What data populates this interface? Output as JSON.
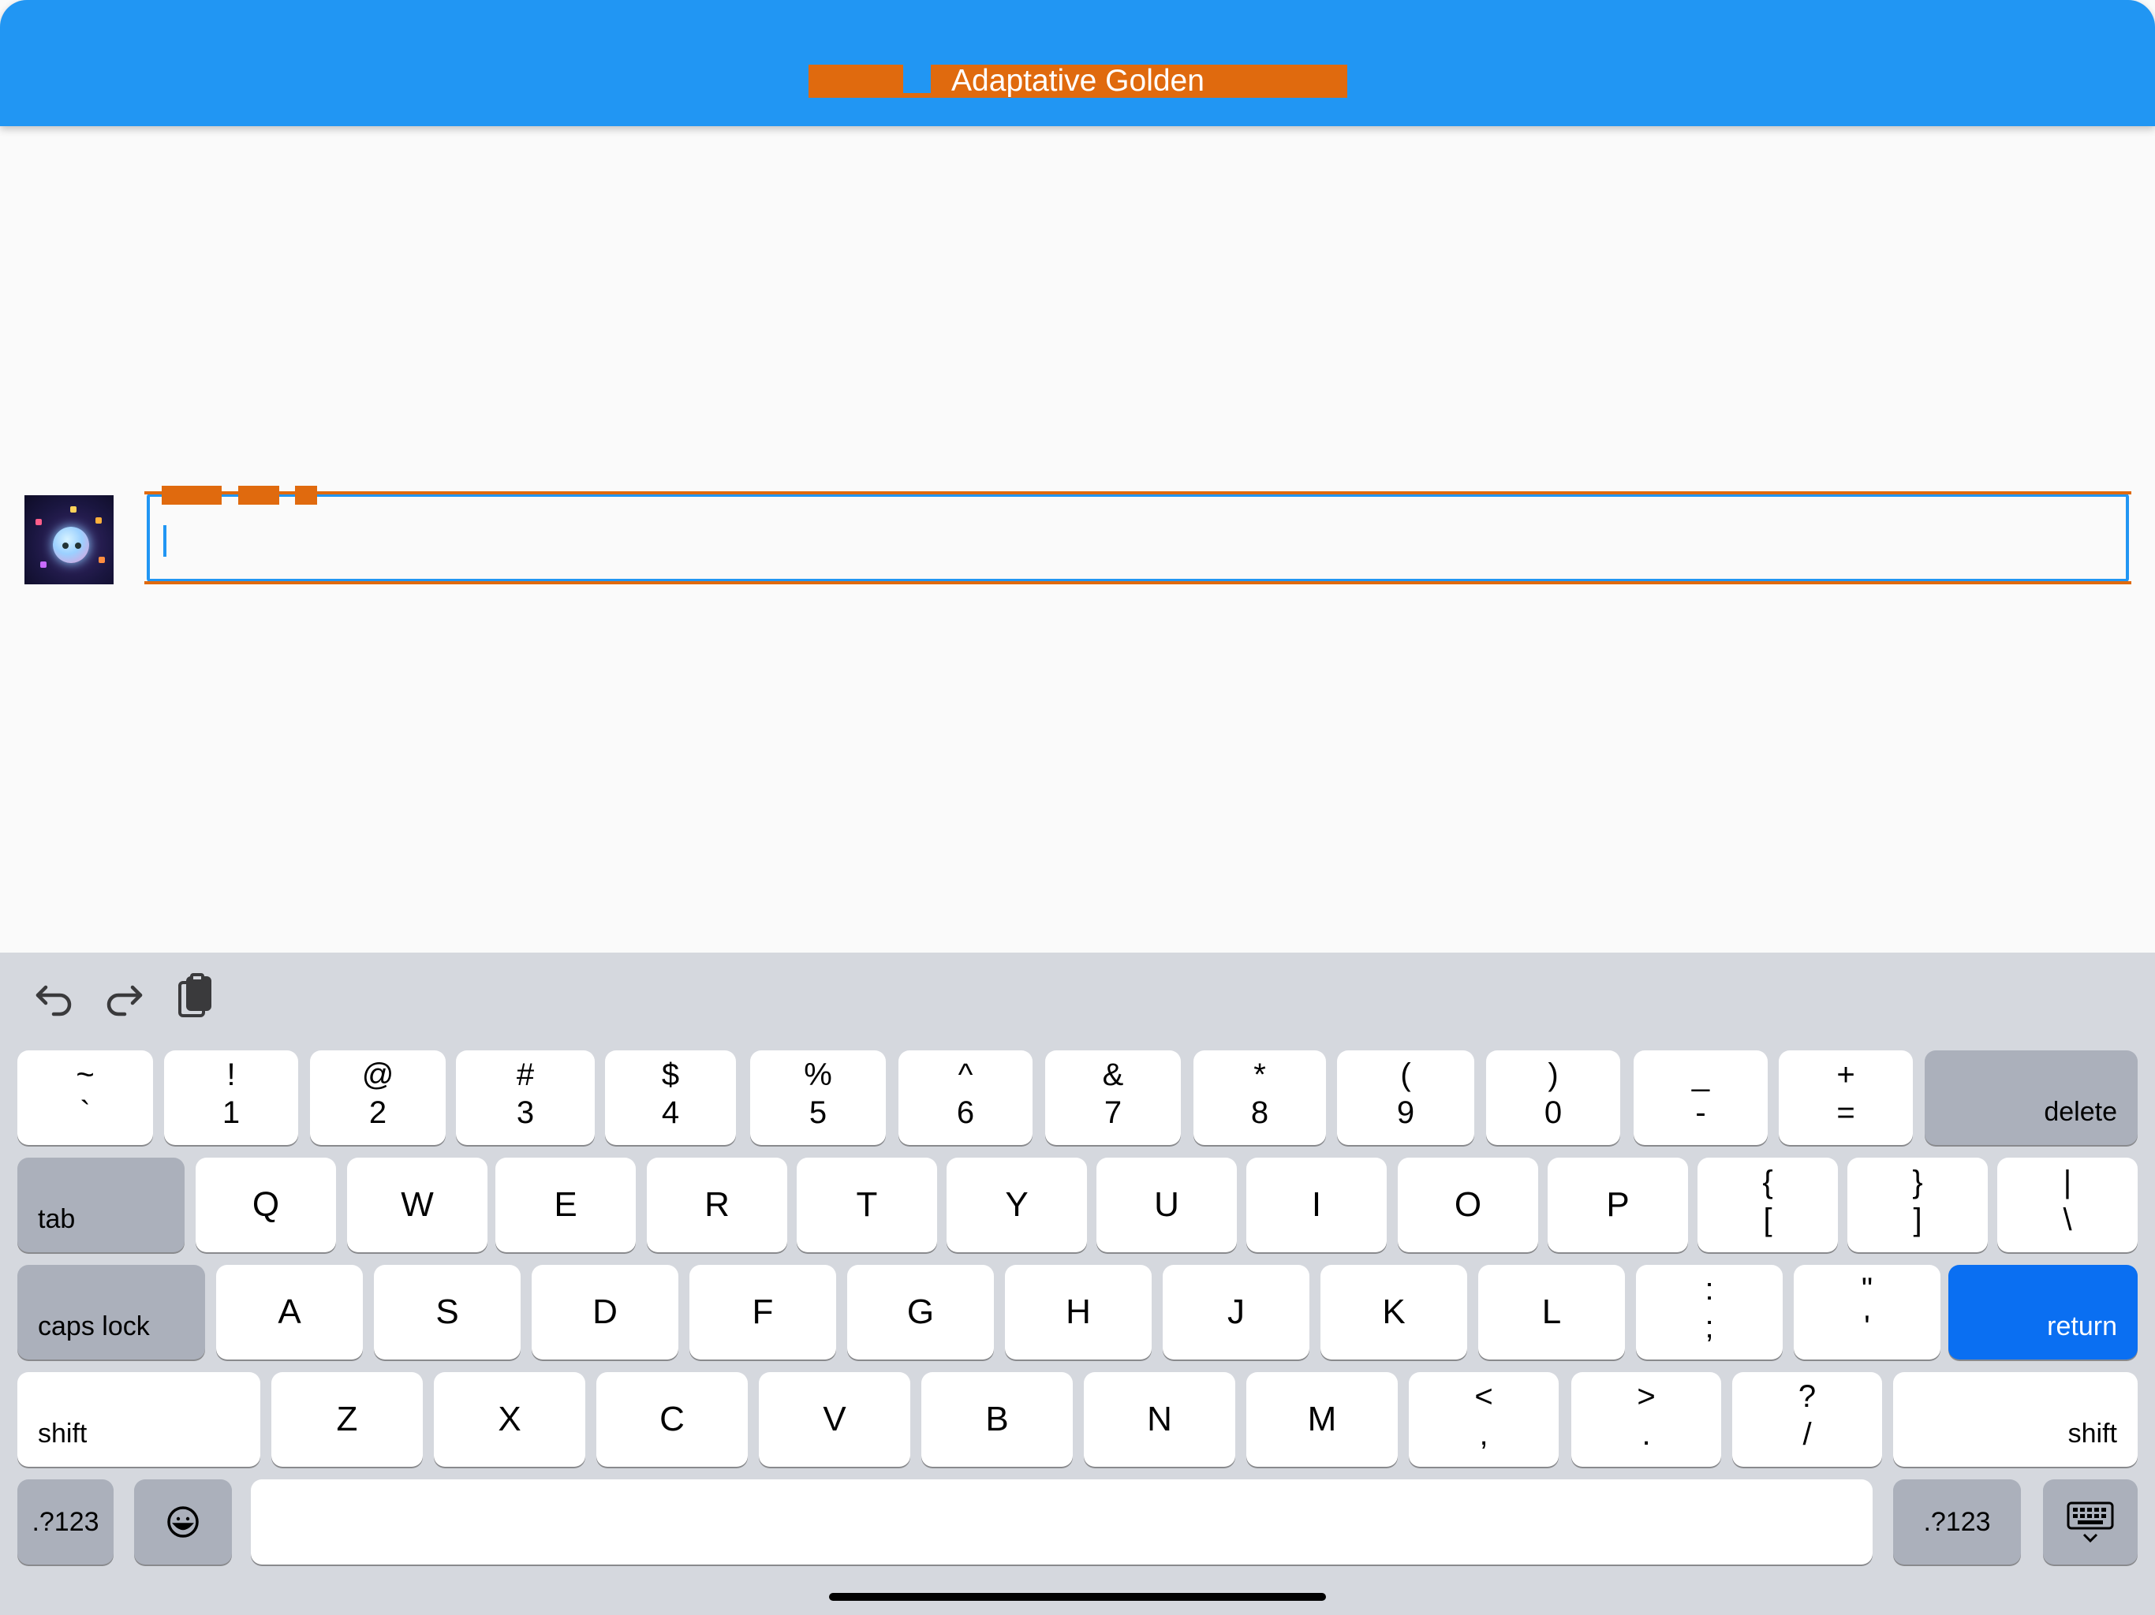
{
  "app": {
    "title": "Adaptative Golden",
    "colors": {
      "appbar": "#2196f3",
      "overlay": "#e06a0e",
      "field_border": "#2196f3",
      "keyboard_bg": "#d5d8de",
      "return_key": "#0a6ff2"
    }
  },
  "form": {
    "avatar_icon": "avatar-image",
    "input_value": ""
  },
  "keyboard": {
    "toolbar": [
      "undo-icon",
      "redo-icon",
      "paste-icon"
    ],
    "row1": [
      {
        "top": "~",
        "bottom": "`"
      },
      {
        "top": "!",
        "bottom": "1"
      },
      {
        "top": "@",
        "bottom": "2"
      },
      {
        "top": "#",
        "bottom": "3"
      },
      {
        "top": "$",
        "bottom": "4"
      },
      {
        "top": "%",
        "bottom": "5"
      },
      {
        "top": "^",
        "bottom": "6"
      },
      {
        "top": "&",
        "bottom": "7"
      },
      {
        "top": "*",
        "bottom": "8"
      },
      {
        "top": "(",
        "bottom": "9"
      },
      {
        "top": ")",
        "bottom": "0"
      },
      {
        "top": "_",
        "bottom": "-"
      },
      {
        "top": "+",
        "bottom": "="
      }
    ],
    "delete_label": "delete",
    "tab_label": "tab",
    "row2": [
      "Q",
      "W",
      "E",
      "R",
      "T",
      "Y",
      "U",
      "I",
      "O",
      "P"
    ],
    "row2_pairs": [
      {
        "top": "{",
        "bottom": "["
      },
      {
        "top": "}",
        "bottom": "]"
      },
      {
        "top": "|",
        "bottom": "\\"
      }
    ],
    "caps_label": "caps lock",
    "row3": [
      "A",
      "S",
      "D",
      "F",
      "G",
      "H",
      "J",
      "K",
      "L"
    ],
    "row3_pairs": [
      {
        "top": ":",
        "bottom": ";"
      },
      {
        "top": "\"",
        "bottom": "'"
      }
    ],
    "return_label": "return",
    "shift_label": "shift",
    "row4": [
      "Z",
      "X",
      "C",
      "V",
      "B",
      "N",
      "M"
    ],
    "row4_pairs": [
      {
        "top": "<",
        "bottom": ","
      },
      {
        "top": ">",
        "bottom": "."
      },
      {
        "top": "?",
        "bottom": "/"
      }
    ],
    "numbers_label": ".?123",
    "space_label": "",
    "emoji_icon": "emoji-icon",
    "dismiss_icon": "keyboard-dismiss-icon"
  }
}
